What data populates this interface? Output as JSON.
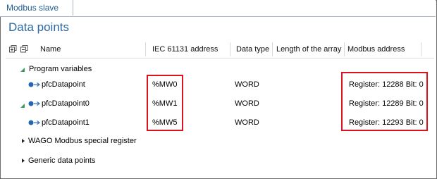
{
  "tab": {
    "label": "Modbus slave"
  },
  "title": "Data points",
  "columns": {
    "name": "Name",
    "iec_address": "IEC 61131  address",
    "data_type": "Data type",
    "array_length": "Length of the array",
    "modbus_address": "Modbus address"
  },
  "groups": [
    {
      "label": "Program variables",
      "expanded": true
    },
    {
      "label": "WAGO Modbus special register",
      "expanded": false
    },
    {
      "label": "Generic data points",
      "expanded": false
    }
  ],
  "rows": [
    {
      "name": "pfcDatapoint",
      "iec_address": "%MW0",
      "data_type": "WORD",
      "modbus_address": "Register: 12288 Bit: 0"
    },
    {
      "name": "pfcDatapoint0",
      "iec_address": "%MW1",
      "data_type": "WORD",
      "modbus_address": "Register: 12289 Bit: 0"
    },
    {
      "name": "pfcDatapoint1",
      "iec_address": "%MW5",
      "data_type": "WORD",
      "modbus_address": "Register: 12293 Bit: 0"
    }
  ],
  "colors": {
    "accent": "#2d6aa0",
    "highlight": "#d9141e",
    "expand_arrow": "#3c9a5f"
  }
}
